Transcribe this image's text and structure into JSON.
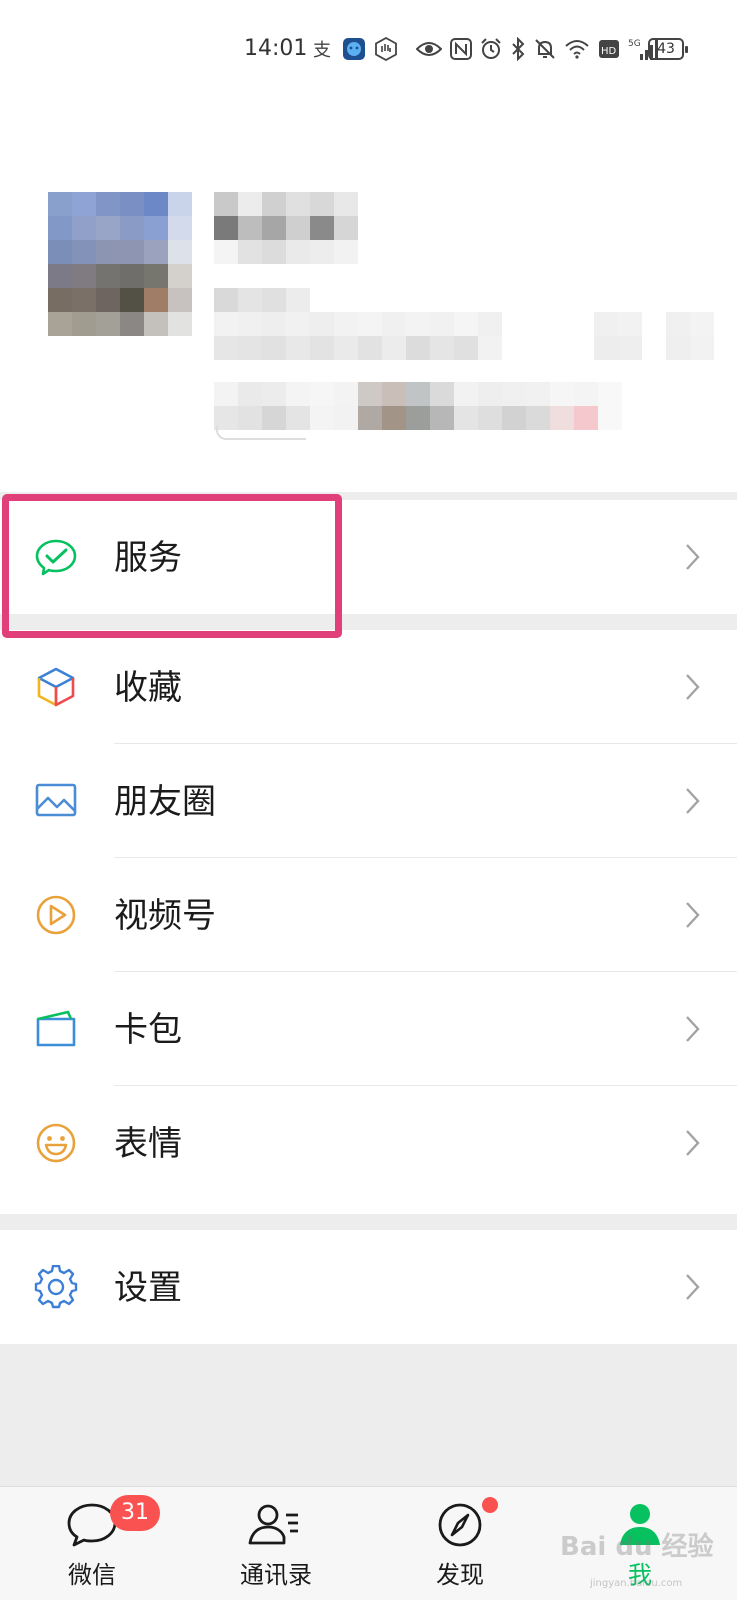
{
  "status_bar": {
    "time": "14:01",
    "network": "5G",
    "hd": "HD",
    "battery": "43",
    "icons": [
      "alipay-icon",
      "app-face-icon",
      "hand-icon",
      "eye-icon",
      "nfc-icon",
      "alarm-icon",
      "bluetooth-icon",
      "mute-icon",
      "wifi-icon",
      "hd-icon",
      "signal-icon",
      "battery-icon"
    ]
  },
  "profile": {
    "avatar": "pixelated-avatar",
    "name": "",
    "wechat_id": "",
    "status": ""
  },
  "menu": {
    "service": {
      "label": "服务",
      "icon": "service-check-icon",
      "color": "#07c160"
    },
    "favorites": {
      "label": "收藏",
      "icon": "favorites-cube-icon"
    },
    "moments": {
      "label": "朋友圈",
      "icon": "moments-picture-icon",
      "color": "#4a8cd6"
    },
    "channels": {
      "label": "视频号",
      "icon": "channels-play-icon",
      "color": "#e9a23b"
    },
    "cards": {
      "label": "卡包",
      "icon": "card-wallet-icon",
      "color": "#3d8ed8"
    },
    "stickers": {
      "label": "表情",
      "icon": "sticker-smile-icon",
      "color": "#e9a23b"
    },
    "settings": {
      "label": "设置",
      "icon": "settings-gear-icon",
      "color": "#3d7fd6"
    }
  },
  "highlight": {
    "color": "#e03f7a",
    "target": "服务"
  },
  "tabbar": {
    "chats": {
      "label": "微信",
      "badge": "31"
    },
    "contacts": {
      "label": "通讯录"
    },
    "discover": {
      "label": "发现",
      "dot": true
    },
    "me": {
      "label": "我",
      "active": true
    }
  },
  "watermark": {
    "text": "Bai du 经验",
    "sub": "jingyan.baidu.com"
  }
}
